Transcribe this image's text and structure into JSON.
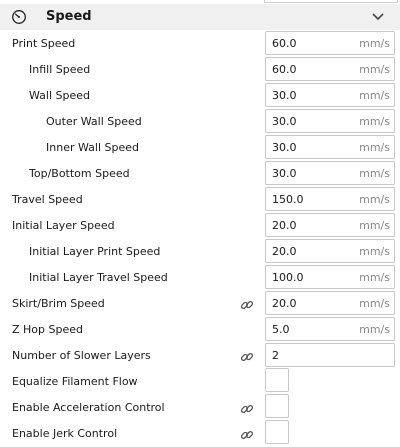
{
  "category": {
    "title": "Speed",
    "icon": "speedometer-icon",
    "chevron": "chevron-down-icon"
  },
  "settings": [
    {
      "label": "Print Speed",
      "value": "60.0",
      "unit": "mm/s"
    },
    {
      "label": "Infill Speed",
      "value": "60.0",
      "unit": "mm/s"
    },
    {
      "label": "Wall Speed",
      "value": "30.0",
      "unit": "mm/s"
    },
    {
      "label": "Outer Wall Speed",
      "value": "30.0",
      "unit": "mm/s"
    },
    {
      "label": "Inner Wall Speed",
      "value": "30.0",
      "unit": "mm/s"
    },
    {
      "label": "Top/Bottom Speed",
      "value": "30.0",
      "unit": "mm/s"
    },
    {
      "label": "Travel Speed",
      "value": "150.0",
      "unit": "mm/s"
    },
    {
      "label": "Initial Layer Speed",
      "value": "20.0",
      "unit": "mm/s"
    },
    {
      "label": "Initial Layer Print Speed",
      "value": "20.0",
      "unit": "mm/s"
    },
    {
      "label": "Initial Layer Travel Speed",
      "value": "100.0",
      "unit": "mm/s"
    },
    {
      "label": "Skirt/Brim Speed",
      "value": "20.0",
      "unit": "mm/s",
      "linked": true
    },
    {
      "label": "Z Hop Speed",
      "value": "5.0",
      "unit": "mm/s"
    },
    {
      "label": "Number of Slower Layers",
      "value": "2",
      "unit": "",
      "linked": true
    },
    {
      "label": "Equalize Filament Flow",
      "type": "checkbox",
      "checked": false
    },
    {
      "label": "Enable Acceleration Control",
      "type": "checkbox",
      "checked": false,
      "linked": true
    },
    {
      "label": "Enable Jerk Control",
      "type": "checkbox",
      "checked": false,
      "linked": true
    }
  ]
}
